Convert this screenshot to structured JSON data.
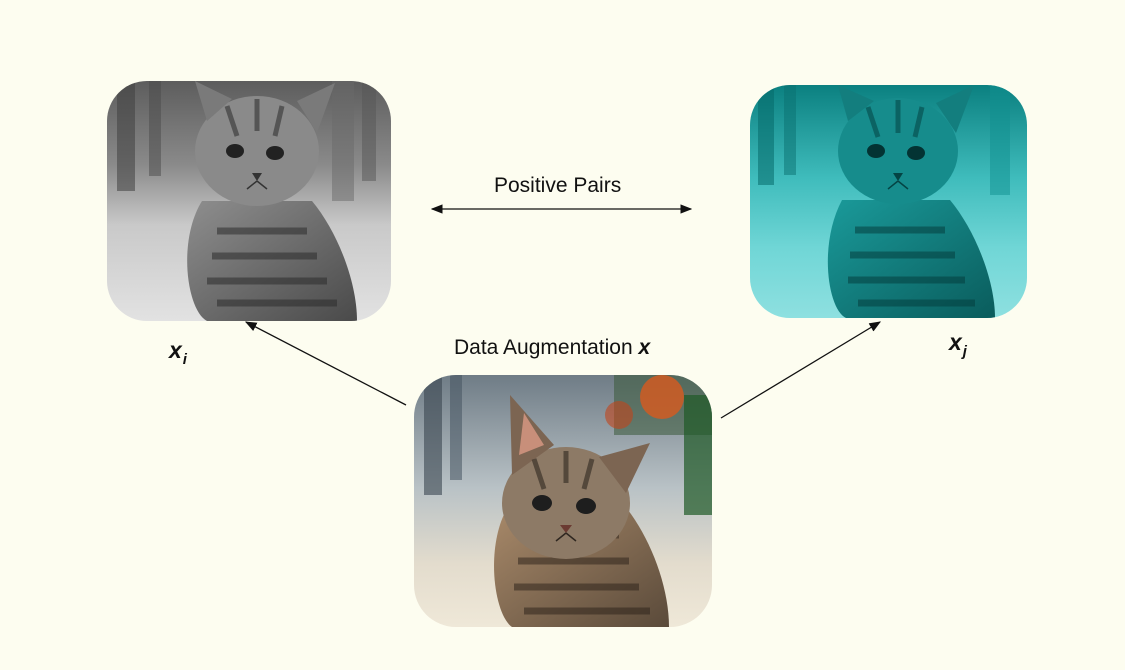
{
  "diagram": {
    "positive_pairs_label": "Positive Pairs",
    "augmentation_label": "Data Augmentation",
    "augmentation_var": "x",
    "view_i": {
      "base": "x",
      "subscript": "i",
      "treatment": "grayscale"
    },
    "view_j": {
      "base": "x",
      "subscript": "j",
      "treatment": "cyan-tint"
    },
    "source": {
      "treatment": "original-color"
    }
  },
  "colors": {
    "background": "#fdfdf0",
    "text": "#111111",
    "arrow": "#111111",
    "cyan_tint": "#1fbfbf"
  }
}
